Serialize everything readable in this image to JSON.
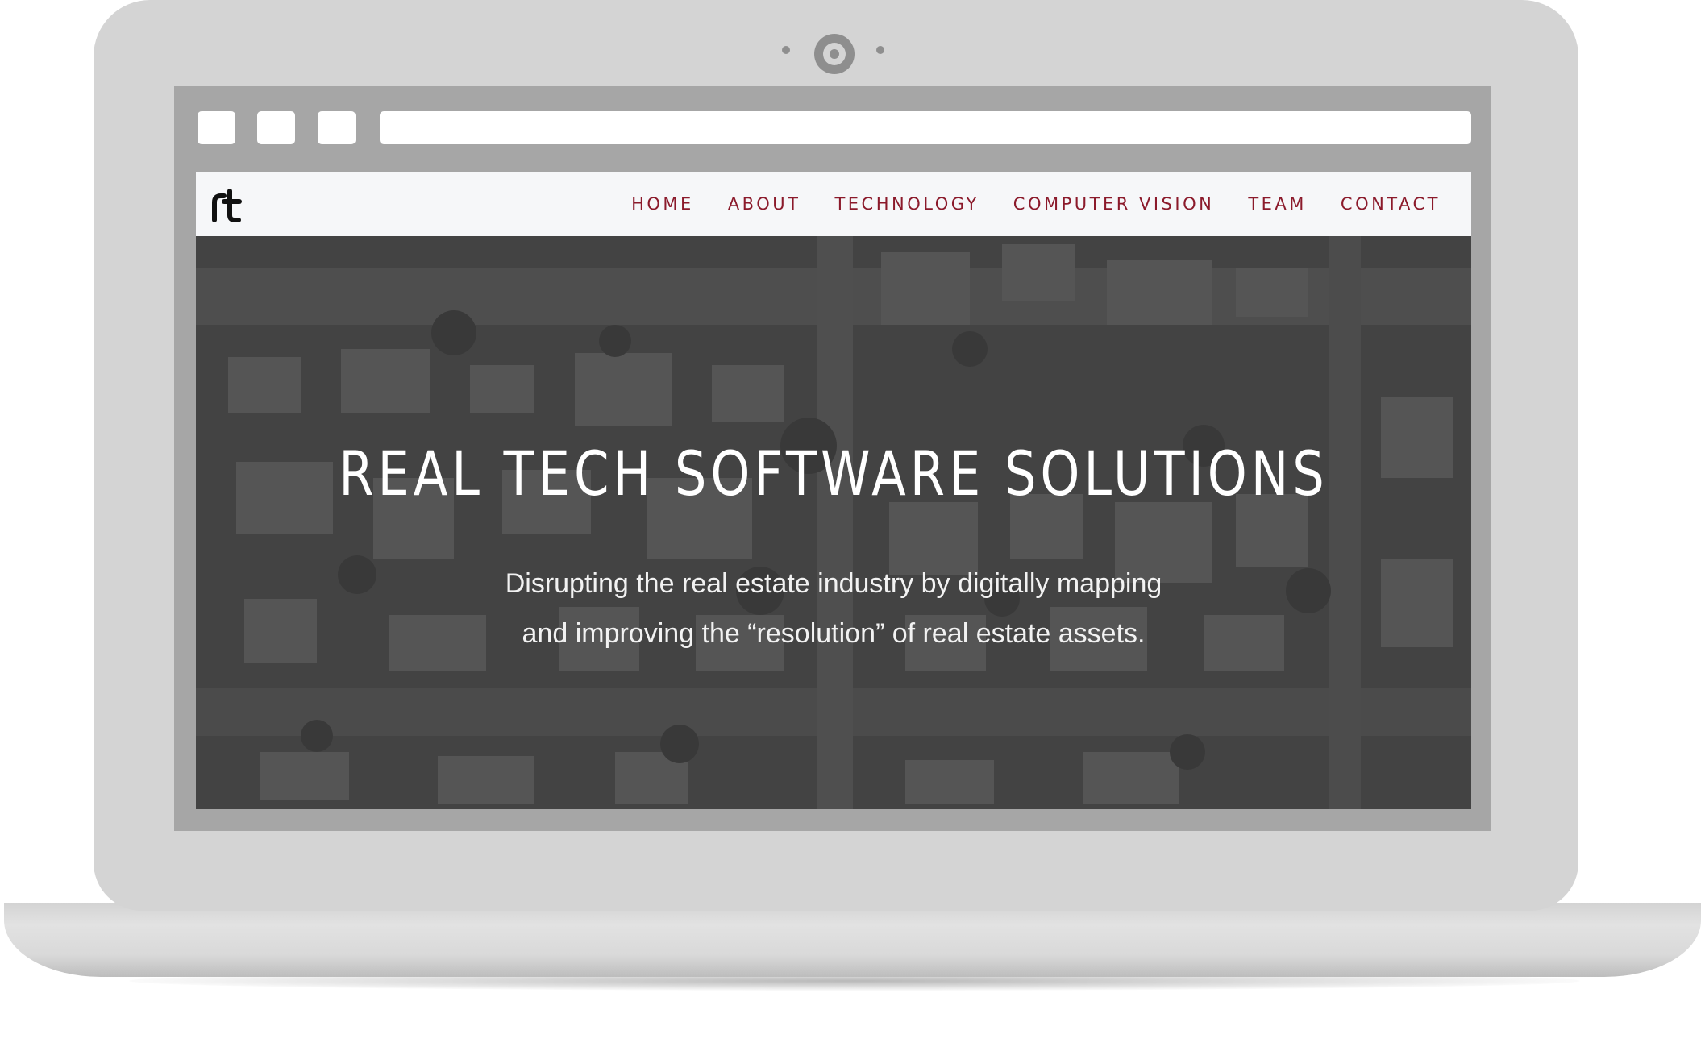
{
  "site": {
    "logo_text": "rt",
    "nav": {
      "items": [
        {
          "label": "HOME"
        },
        {
          "label": "ABOUT"
        },
        {
          "label": "TECHNOLOGY"
        },
        {
          "label": "COMPUTER VISION"
        },
        {
          "label": "TEAM"
        },
        {
          "label": "CONTACT"
        }
      ]
    },
    "hero": {
      "title": "REAL TECH SOFTWARE SOLUTIONS",
      "subtitle_line1": "Disrupting the real estate industry by digitally mapping",
      "subtitle_line2": "and improving the “resolution” of real estate assets."
    }
  },
  "colors": {
    "nav_text": "#8b1a2b",
    "laptop_body": "#d4d4d4",
    "bezel": "#a6a6a6",
    "navbar_bg": "#f6f7f9"
  }
}
